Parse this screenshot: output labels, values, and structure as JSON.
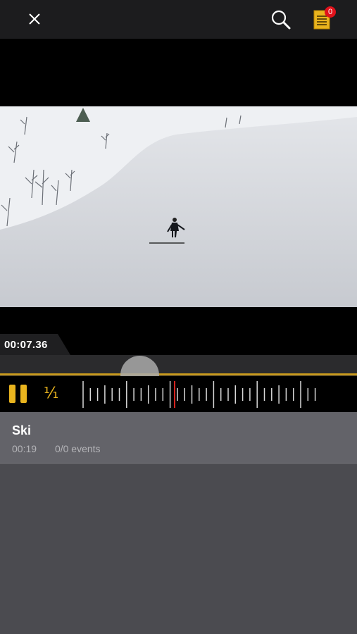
{
  "toolbar": {
    "close_icon": "close-icon",
    "search_icon": "search-icon",
    "notes_icon": "notes-icon",
    "notes_badge": "0",
    "accent_color": "#e9b41e",
    "badge_color": "#e0121b"
  },
  "player": {
    "timecode": "00:07.36",
    "playback_state": "playing",
    "pause_icon": "pause-icon",
    "speed_label": "¹⁄₁",
    "progress_fraction": 0.39
  },
  "clip": {
    "title": "Ski",
    "duration": "00:19",
    "events": "0/0 events"
  }
}
